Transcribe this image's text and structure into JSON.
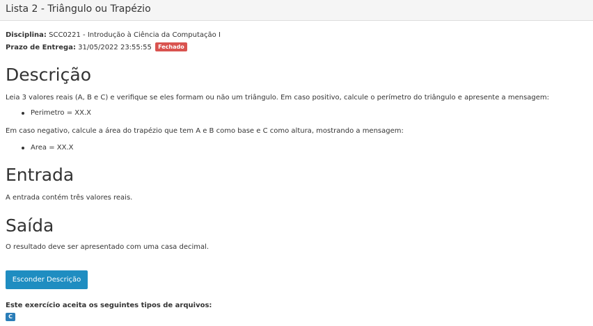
{
  "header": {
    "title": "Lista 2 - Triângulo ou Trapézio"
  },
  "meta": {
    "discipline_label": "Disciplina:",
    "discipline_value": "SCC0221 - Introdução à Ciência da Computação I",
    "deadline_label": "Prazo de Entrega:",
    "deadline_value": "31/05/2022 23:55:55",
    "status_badge": "Fechado"
  },
  "description": {
    "heading": "Descrição",
    "para1": "Leia 3 valores reais (A, B e C) e verifique se eles formam ou não um triângulo. Em caso positivo, calcule o perímetro do triângulo e apresente a mensagem:",
    "list1": [
      "Perimetro = XX.X"
    ],
    "para2": "Em caso negativo, calcule a área do trapézio que tem A e B como base e C como altura, mostrando a mensagem:",
    "list2": [
      "Area = XX.X"
    ]
  },
  "input": {
    "heading": "Entrada",
    "text": "A entrada contém três valores reais."
  },
  "output": {
    "heading": "Saída",
    "text": "O resultado deve ser apresentado com uma casa decimal."
  },
  "actions": {
    "hide_description_label": "Esconder Descrição"
  },
  "file_types": {
    "label": "Este exercício aceita os seguintes tipos de arquivos:",
    "types": [
      "C"
    ]
  },
  "colors": {
    "header_bg": "#f5f5f5",
    "badge_closed": "#d9534f",
    "button_primary": "#1f8dc1",
    "file_type_badge": "#2a7db8"
  }
}
